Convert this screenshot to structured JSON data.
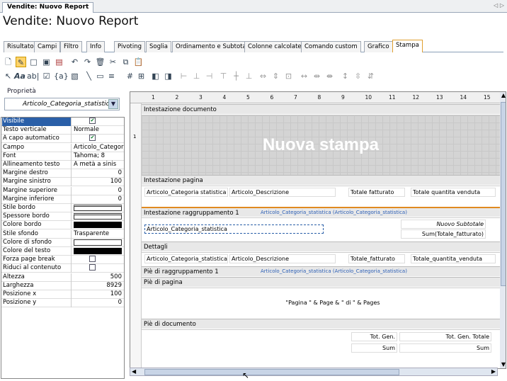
{
  "window": {
    "doc_tab": "Vendite: Nuovo Report",
    "title": "Vendite: Nuovo Report"
  },
  "tabs": [
    {
      "label": "Risultato"
    },
    {
      "label": "Campi"
    },
    {
      "label": "Filtro"
    },
    {
      "label": "Info"
    },
    {
      "label": "Pivoting"
    },
    {
      "label": "Soglia"
    },
    {
      "label": "Ordinamento e Subtotali"
    },
    {
      "label": "Colonne calcolate"
    },
    {
      "label": "Comando custom"
    },
    {
      "label": "Grafico"
    },
    {
      "label": "Stampa"
    }
  ],
  "active_tab": "Stampa",
  "toolbar1_icons": [
    "preview-icon",
    "design-icon",
    "new-icon",
    "save-icon",
    "open-icon",
    "undo-icon",
    "redo-icon",
    "delete-icon",
    "cut-icon",
    "copy-icon",
    "paste-icon"
  ],
  "toolbar2_icons": [
    "pointer-icon",
    "label-tool-icon",
    "textbox-tool-icon",
    "checkbox-tool-icon",
    "field-tool-icon",
    "image-tool-icon",
    "line-tool-icon",
    "rect-tool-icon",
    "section-tool-icon",
    "grid-icon",
    "snap-icon",
    "bring-front-icon",
    "send-back-icon",
    "align-left-icon",
    "align-center-icon",
    "align-right-icon",
    "align-top-icon",
    "align-middle-icon",
    "align-bottom-icon",
    "same-width-icon",
    "same-height-icon",
    "same-size-icon",
    "space-h-icon",
    "space-h-inc-icon",
    "space-h-dec-icon",
    "space-v-icon",
    "space-v-inc-icon",
    "space-v-dec-icon"
  ],
  "properties": {
    "label": "Proprietà",
    "selected_object": "Articolo_Categoria_statistica",
    "rows": [
      {
        "key": "Visibile",
        "type": "check",
        "value": true
      },
      {
        "key": "Testo verticale",
        "value": "Normale"
      },
      {
        "key": "A capo automatico",
        "type": "check",
        "value": true
      },
      {
        "key": "Campo",
        "value": "Articolo_Categori"
      },
      {
        "key": "Font",
        "value": "Tahoma; 8"
      },
      {
        "key": "Allineamento testo",
        "value": "A metà a sinis"
      },
      {
        "key": "Margine destro",
        "value": "0",
        "align": "right"
      },
      {
        "key": "Margine sinistro",
        "value": "100",
        "align": "right"
      },
      {
        "key": "Margine superiore",
        "value": "0",
        "align": "right"
      },
      {
        "key": "Margine inferiore",
        "value": "0",
        "align": "right"
      },
      {
        "key": "Stile bordo",
        "type": "line"
      },
      {
        "key": "Spessore bordo",
        "type": "line"
      },
      {
        "key": "Colore bordo",
        "type": "black"
      },
      {
        "key": "Stile sfondo",
        "value": "Trasparente"
      },
      {
        "key": "Colore di sfondo",
        "type": "white"
      },
      {
        "key": "Colore del testo",
        "type": "black"
      },
      {
        "key": "Forza page break",
        "type": "check",
        "value": false
      },
      {
        "key": "Riduci al contenuto",
        "type": "check",
        "value": false
      },
      {
        "key": "Altezza",
        "value": "500",
        "align": "right"
      },
      {
        "key": "Larghezza",
        "value": "8929",
        "align": "right"
      },
      {
        "key": "Posizione x",
        "value": "100",
        "align": "right"
      },
      {
        "key": "Posizione y",
        "value": "0",
        "align": "right"
      }
    ]
  },
  "ruler": [
    "1",
    "2",
    "3",
    "4",
    "5",
    "6",
    "7",
    "8",
    "9",
    "10",
    "11",
    "12",
    "13",
    "14",
    "15"
  ],
  "sections": {
    "doc_header": "Intestazione documento",
    "big_title": "Nuova stampa",
    "page_header": "Intestazione pagina",
    "page_header_cells": [
      "Articolo_Categoria statistica",
      "Articolo_Descrizione",
      "Totale fatturato",
      "Totale quantita venduta"
    ],
    "group_header": "Intestazione raggruppamento 1",
    "group_field": "Articolo_Categoria_statistica (Articolo_Categoria_statistica)",
    "group_cell": "Articolo_Categoria_statistica",
    "subtotal_label": "Nuovo Subtotale",
    "subtotal_expr": "Sum(Totale_fatturato)",
    "details": "Dettagli",
    "detail_cells": [
      "Articolo_Categoria_statistica",
      "Articolo_Descrizione",
      "Totale_fatturato",
      "Totale_quantita_venduta"
    ],
    "group_footer": "Piè di raggruppamento 1",
    "group_footer_field": "Articolo_Categoria_statistica (Articolo_Categoria_statistica)",
    "page_footer": "Piè di pagina",
    "page_footer_expr": "\"Pagina \" & Page & \" di \" & Pages",
    "doc_footer": "Piè di documento",
    "footer_cells": [
      "Tot. Gen.",
      "Tot. Gen. Totale",
      "Sum",
      "Sum"
    ]
  },
  "colors": {
    "selection": "#2a5fa8",
    "accent_tab": "#e0a030",
    "group_text": "#2c5fb6"
  }
}
